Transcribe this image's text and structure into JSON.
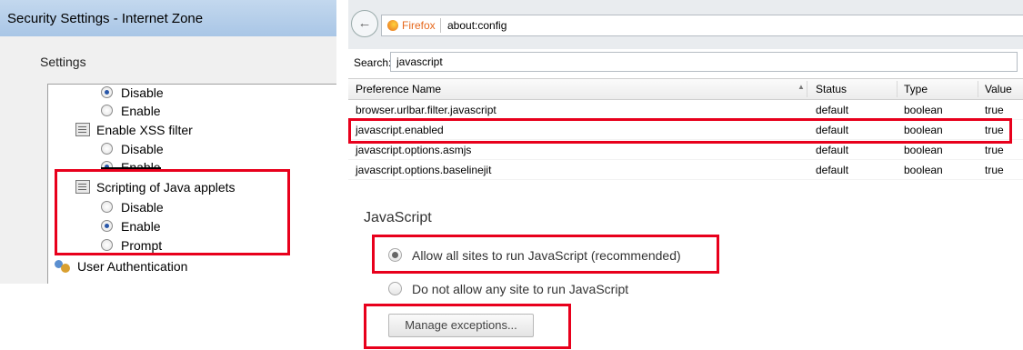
{
  "ie": {
    "title": "Security Settings - Internet Zone",
    "settings_label": "Settings",
    "rows": [
      {
        "type": "radio",
        "label": "Disable",
        "checked": true
      },
      {
        "type": "radio",
        "label": "Enable",
        "checked": false
      },
      {
        "type": "group",
        "label": "Enable XSS filter"
      },
      {
        "type": "radio",
        "label": "Disable",
        "checked": false
      },
      {
        "type": "radio",
        "label": "Enable",
        "checked": true
      },
      {
        "type": "group",
        "label": "Scripting of Java applets"
      },
      {
        "type": "radio",
        "label": "Disable",
        "checked": false
      },
      {
        "type": "radio",
        "label": "Enable",
        "checked": true
      },
      {
        "type": "radio",
        "label": "Prompt",
        "checked": false
      },
      {
        "type": "group",
        "label": "User Authentication"
      }
    ]
  },
  "ff": {
    "brand": "Firefox",
    "url": "about:config",
    "search_label": "Search:",
    "search_value": "javascript",
    "columns": [
      "Preference Name",
      "Status",
      "Type",
      "Value"
    ],
    "rows": [
      [
        "browser.urlbar.filter.javascript",
        "default",
        "boolean",
        "true"
      ],
      [
        "javascript.enabled",
        "default",
        "boolean",
        "true"
      ],
      [
        "javascript.options.asmjs",
        "default",
        "boolean",
        "true"
      ],
      [
        "javascript.options.baselinejit",
        "default",
        "boolean",
        "true"
      ]
    ]
  },
  "chrome": {
    "heading": "JavaScript",
    "allow_label": "Allow all sites to run JavaScript (recommended)",
    "deny_label": "Do not allow any site to run JavaScript",
    "manage_button": "Manage exceptions..."
  },
  "colors": {
    "highlight": "#e8001c",
    "ie_titlebar": "#b6cfea",
    "ff_brand": "#e6681c"
  }
}
